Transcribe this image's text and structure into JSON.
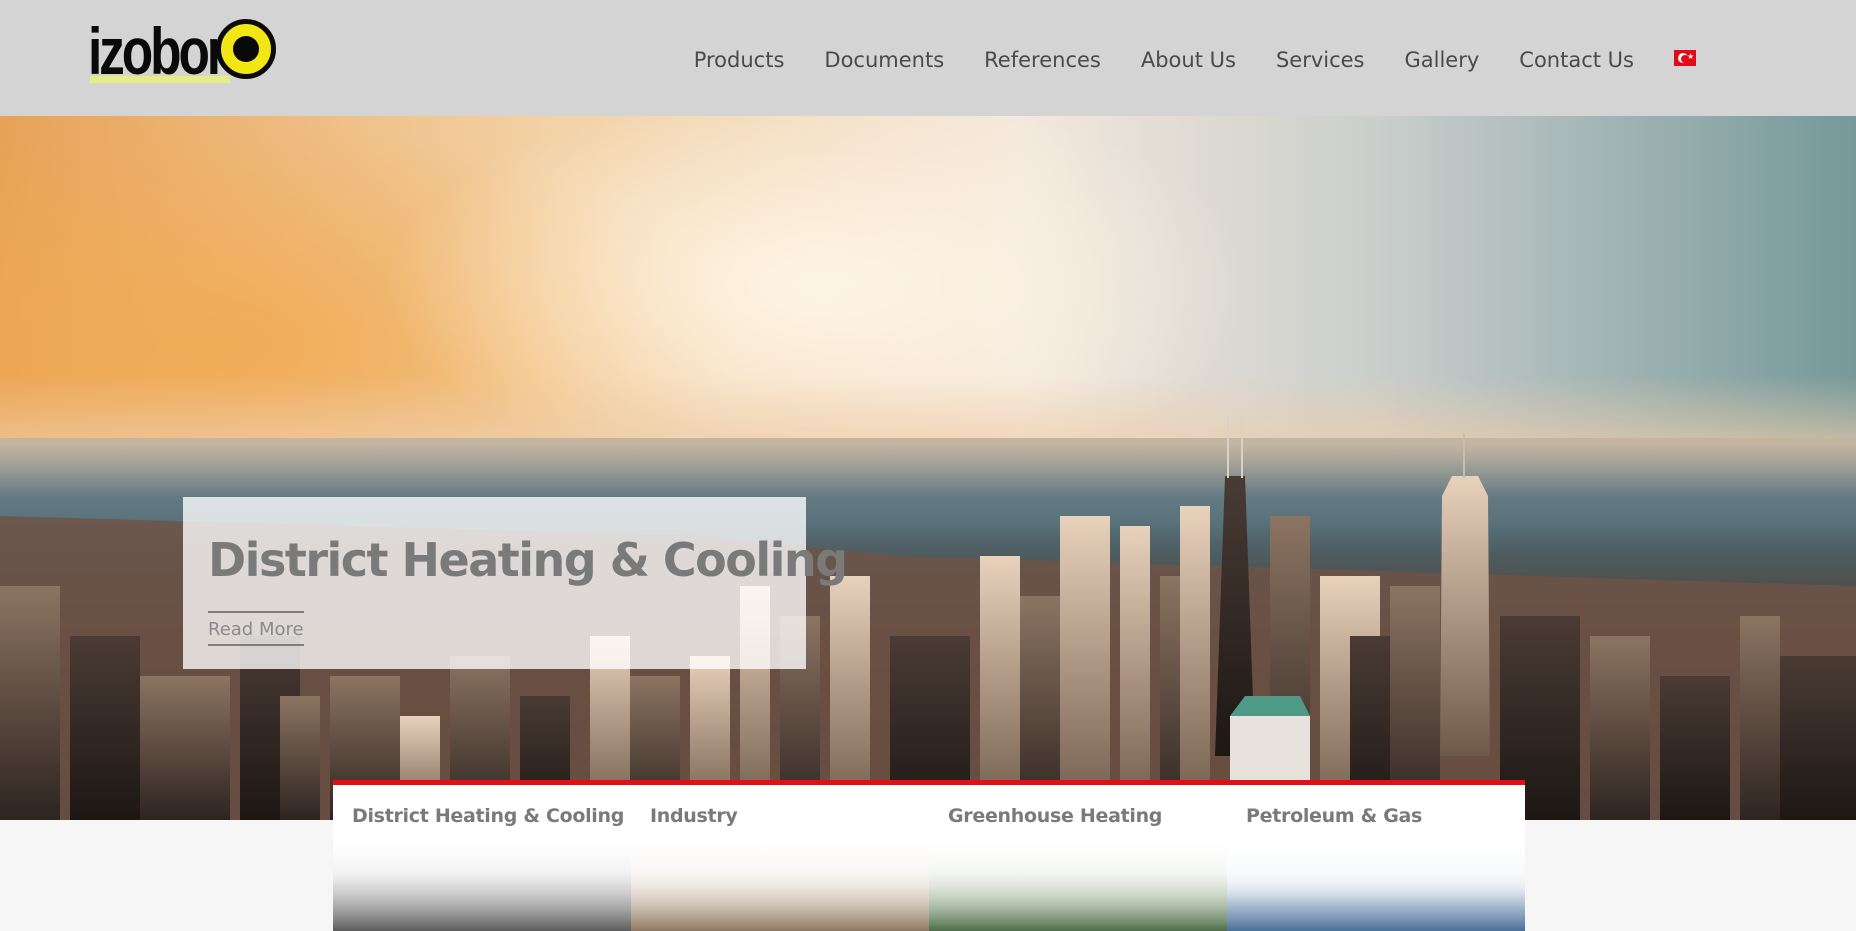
{
  "header": {
    "logo_text": "izobor",
    "nav": [
      {
        "label": "Products"
      },
      {
        "label": "Documents"
      },
      {
        "label": "References"
      },
      {
        "label": "About Us"
      },
      {
        "label": "Services"
      },
      {
        "label": "Gallery"
      },
      {
        "label": "Contact Us"
      }
    ],
    "language_flag": "turkey-flag-icon"
  },
  "hero": {
    "title": "District Heating & Cooling",
    "cta_label": "Read More"
  },
  "categories": [
    {
      "label": "District Heating & Cooling",
      "image": "city-skyline-image"
    },
    {
      "label": "Industry",
      "image": "cooling-towers-image"
    },
    {
      "label": "Greenhouse Heating",
      "image": "greenhouse-image"
    },
    {
      "label": "Petroleum & Gas",
      "image": "offshore-platform-image"
    }
  ],
  "colors": {
    "header_bg": "#d4d4d4",
    "logo_yellow": "#f2e714",
    "accent_red": "#e10f16",
    "text_gray": "#7a7a7a"
  }
}
